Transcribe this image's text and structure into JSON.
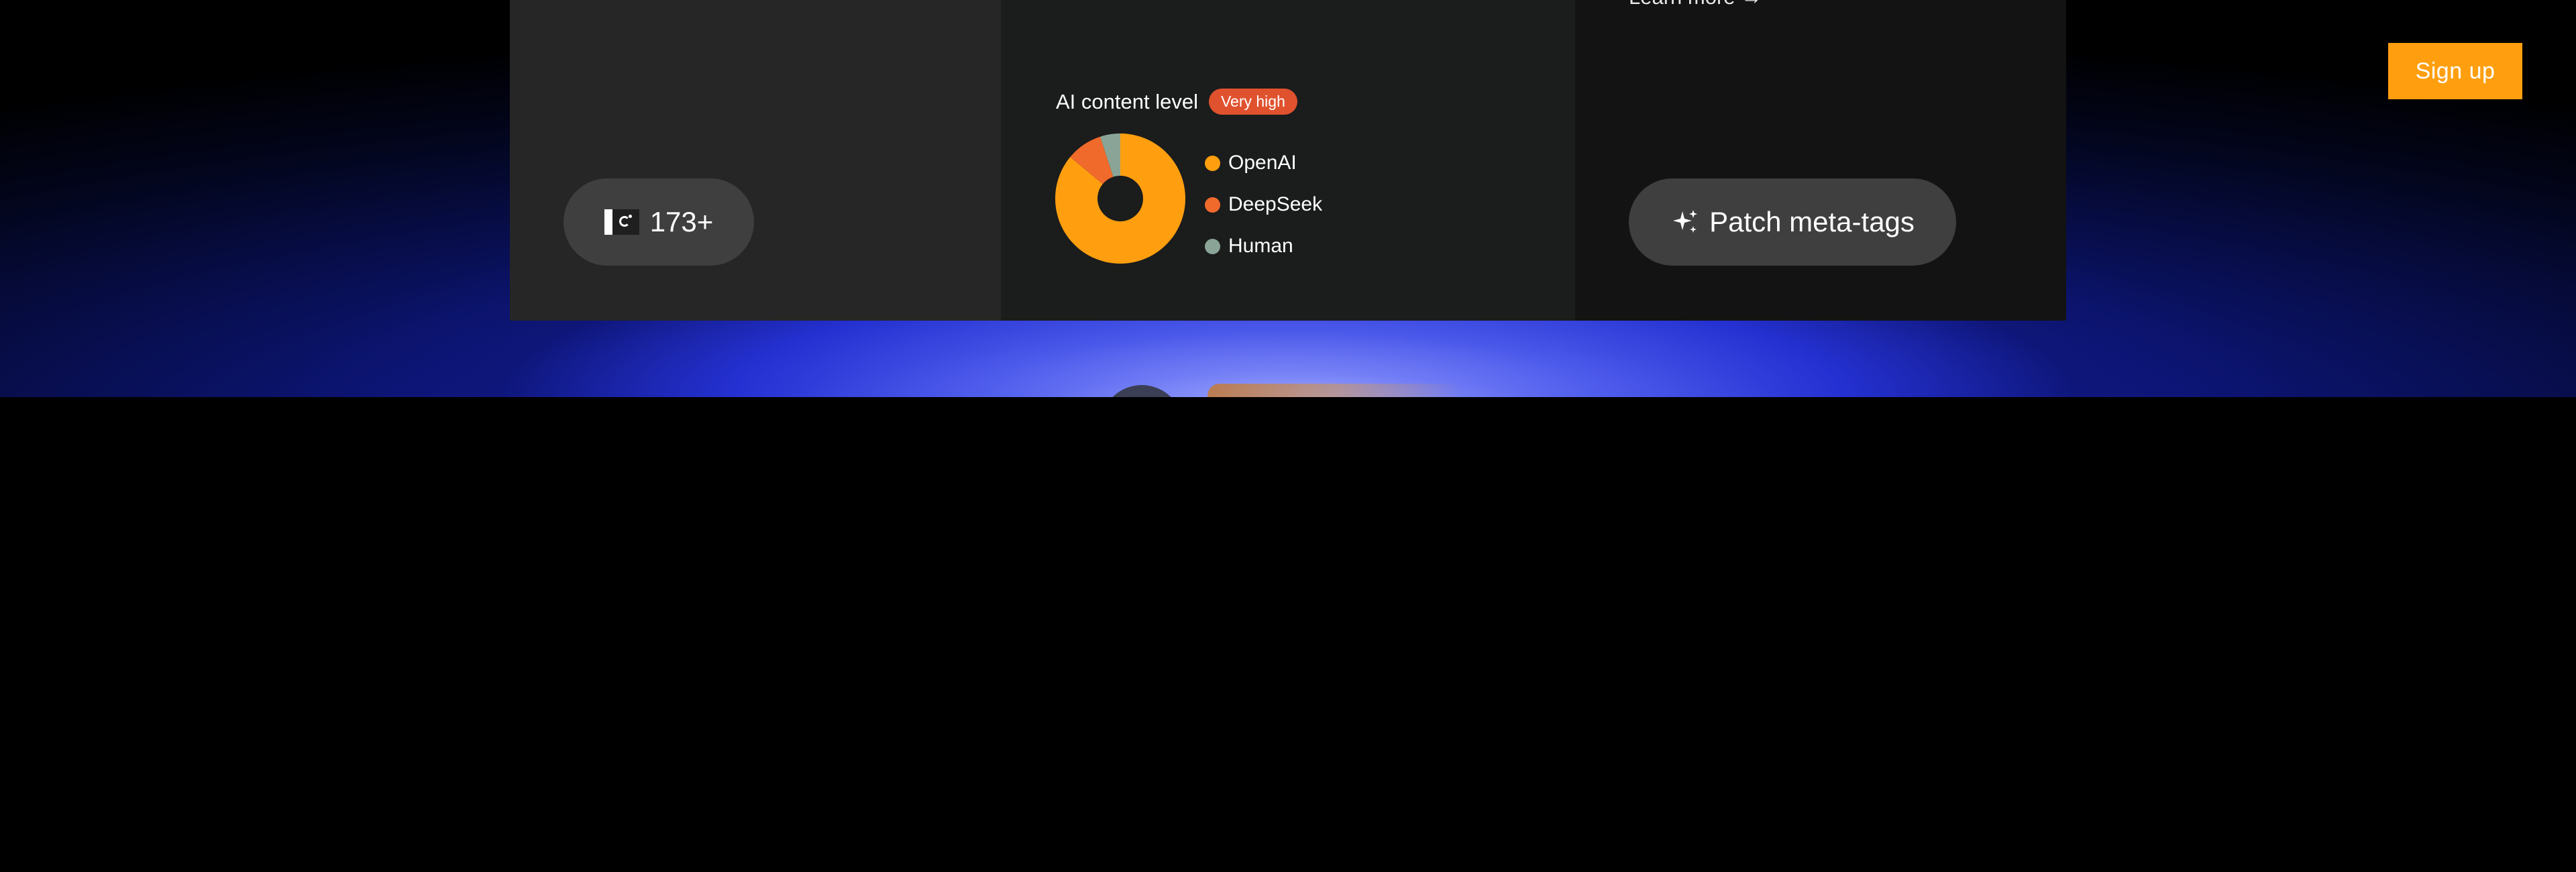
{
  "header": {
    "signup_label": "Sign up"
  },
  "cards": {
    "count_card": {
      "flag_icon": "pakistan-flag-icon",
      "count_label": "173+"
    },
    "ai_card": {
      "title": "AI content level",
      "badge": "Very high",
      "badge_color": "#e0522e",
      "legend": [
        {
          "label": "OpenAI",
          "color": "#ff9f0f"
        },
        {
          "label": "DeepSeek",
          "color": "#f06a2c"
        },
        {
          "label": "Human",
          "color": "#8aa597"
        }
      ]
    },
    "patch_card": {
      "learn_more_label": "Learn more →",
      "sparkle_icon": "sparkles-icon",
      "patch_label": "Patch meta-tags"
    }
  },
  "chart_data": {
    "type": "pie",
    "title": "AI content level",
    "donut": true,
    "categories": [
      "OpenAI",
      "DeepSeek",
      "Human"
    ],
    "values": [
      86,
      9,
      5
    ],
    "colors": [
      "#ff9f0f",
      "#f06a2c",
      "#8aa597"
    ],
    "legend": "right"
  }
}
